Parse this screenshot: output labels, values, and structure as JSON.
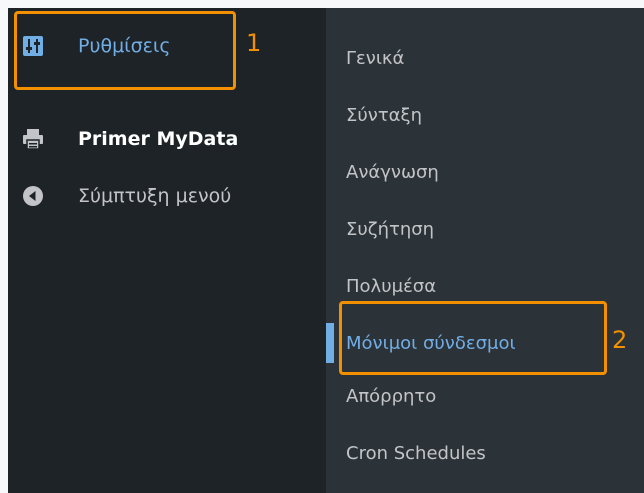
{
  "sidebar": {
    "items": [
      {
        "label": "Ρυθμίσεις",
        "icon": "settings-sliders-icon"
      },
      {
        "label": "Primer MyData",
        "icon": "printer-icon"
      },
      {
        "label": "Σύμπτυξη μενού",
        "icon": "collapse-arrow-icon"
      }
    ]
  },
  "submenu": {
    "items": [
      {
        "label": "Γενικά"
      },
      {
        "label": "Σύνταξη"
      },
      {
        "label": "Ανάγνωση"
      },
      {
        "label": "Συζήτηση"
      },
      {
        "label": "Πολυμέσα"
      },
      {
        "label": "Μόνιμοι σύνδεσμοι",
        "current": true
      },
      {
        "label": "Απόρρητο"
      },
      {
        "label": "Cron Schedules"
      }
    ]
  },
  "annotations": {
    "step1": "1",
    "step2": "2",
    "color": "#f29000"
  },
  "colors": {
    "sidebar_bg": "#1d2327",
    "submenu_bg": "#2c3338",
    "accent": "#72aee6"
  }
}
